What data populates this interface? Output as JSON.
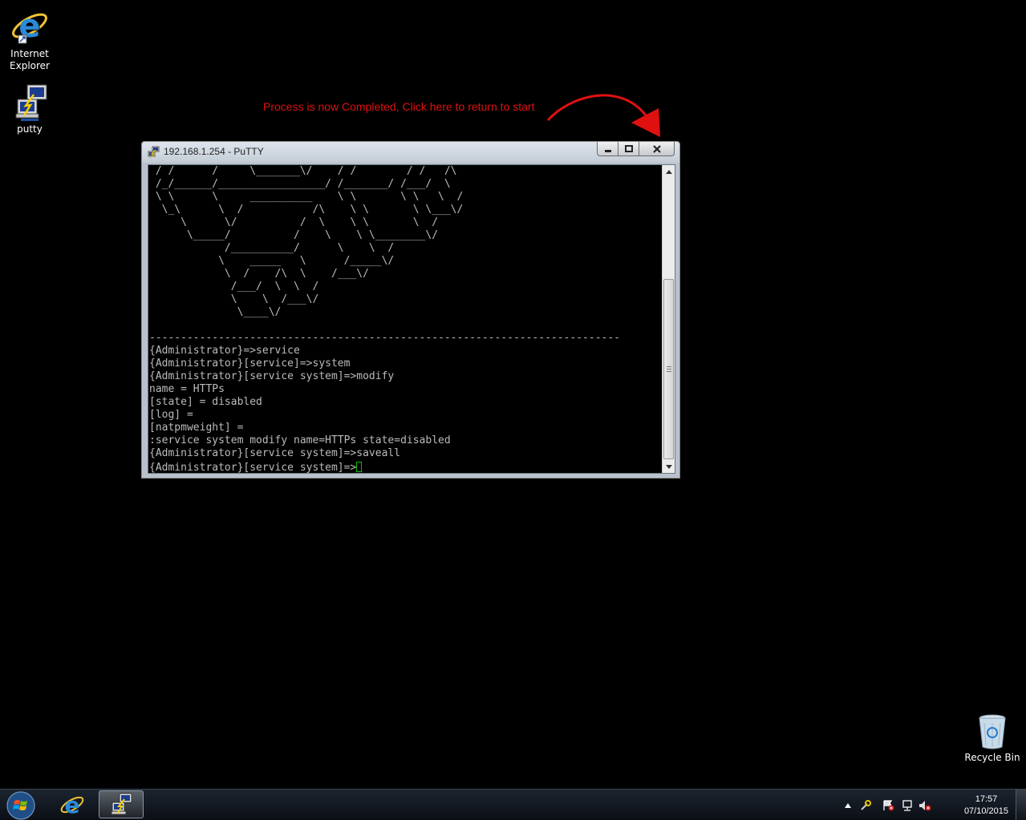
{
  "desktop": {
    "icons": [
      {
        "label_line1": "Internet",
        "label_line2": "Explorer"
      },
      {
        "label_line1": "putty",
        "label_line2": ""
      },
      {
        "label_line1": "Recycle Bin",
        "label_line2": ""
      }
    ]
  },
  "annotation": {
    "text": "Process is now Completed, Click here to return to start",
    "color": "#e01010"
  },
  "putty": {
    "title": "192.168.1.254 - PuTTY",
    "terminal_lines": [
      " / /      /     \\_______\\/    / /        / /   /\\",
      " /_/______/_________________/ /_______/ /___/  \\",
      " \\ \\      \\     __________    \\ \\       \\ \\   \\  /",
      "  \\_\\      \\  /           /\\    \\ \\       \\ \\___\\/",
      "     \\      \\/          /  \\    \\ \\       \\  /",
      "      \\_____/          /    \\    \\ \\________\\/",
      "            /__________/      \\    \\  /",
      "           \\    _____   \\      /_____\\/",
      "            \\  /    /\\  \\    /___\\/",
      "             /___/  \\  \\  /",
      "             \\    \\  /___\\/",
      "              \\____\\/",
      "",
      "---------------------------------------------------------------------------",
      "{Administrator}=>service",
      "{Administrator}[service]=>system",
      "{Administrator}[service system]=>modify",
      "name = HTTPs",
      "[state] = disabled",
      "[log] =",
      "[natpmweight] =",
      ":service system modify name=HTTPs state=disabled",
      "{Administrator}[service system]=>saveall"
    ],
    "prompt": "{Administrator}[service system]=>"
  },
  "taskbar": {
    "clock_time": "17:57",
    "clock_date": "07/10/2015",
    "tray_icons": [
      "show-hidden-icons-arrow",
      "action-center-flag-icon",
      "network-icon",
      "volume-muted-icon"
    ]
  }
}
